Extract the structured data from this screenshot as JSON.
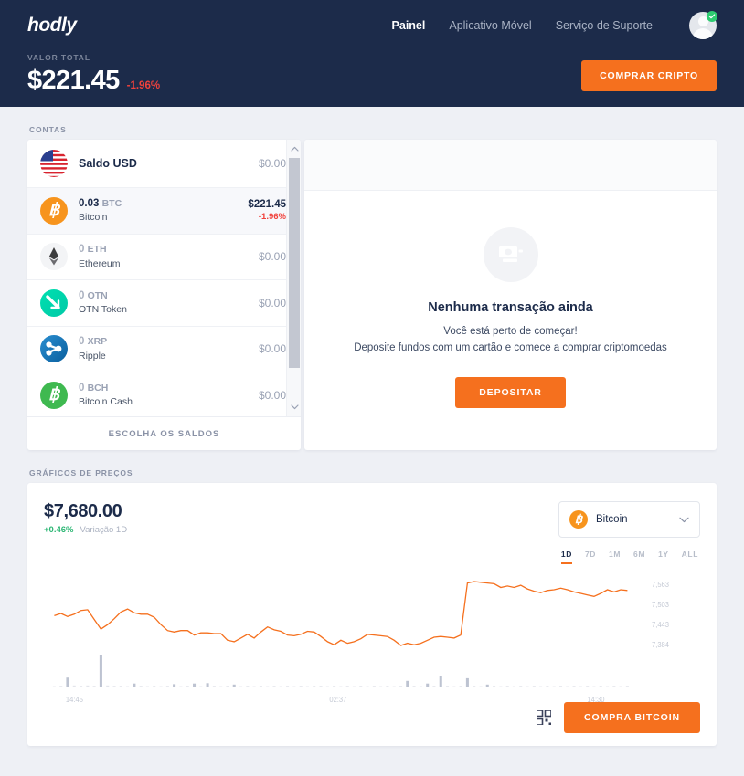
{
  "header": {
    "logo": "hodly",
    "nav": [
      {
        "label": "Painel",
        "active": true
      },
      {
        "label": "Aplicativo Móvel",
        "active": false
      },
      {
        "label": "Serviço de Suporte",
        "active": false
      }
    ],
    "avatar_icon": "user-avatar-icon",
    "avatar_badge_icon": "verified-check-icon",
    "total_label": "VALOR TOTAL",
    "total_value": "$221.45",
    "total_change": "-1.96%",
    "buy_crypto_label": "COMPRAR CRIPTO",
    "bg_color": "#1c2b4a",
    "accent_color": "#f5701e",
    "negative_color": "#f0423c"
  },
  "accounts": {
    "section_label": "CONTAS",
    "rows": [
      {
        "icon": "usd-flag-icon",
        "amount": "",
        "ticker": "",
        "title": "Saldo USD",
        "value": "$0.00",
        "delta": "",
        "selected": false,
        "single_line": true
      },
      {
        "icon": "bitcoin-icon",
        "amount": "0.03",
        "ticker": "BTC",
        "title": "Bitcoin",
        "value": "$221.45",
        "delta": "-1.96%",
        "selected": true,
        "single_line": false
      },
      {
        "icon": "ethereum-icon",
        "amount": "0",
        "ticker": "ETH",
        "title": "Ethereum",
        "value": "$0.00",
        "delta": "",
        "selected": false,
        "single_line": false
      },
      {
        "icon": "otn-token-icon",
        "amount": "0",
        "ticker": "OTN",
        "title": "OTN Token",
        "value": "$0.00",
        "delta": "",
        "selected": false,
        "single_line": false
      },
      {
        "icon": "ripple-icon",
        "amount": "0",
        "ticker": "XRP",
        "title": "Ripple",
        "value": "$0.00",
        "delta": "",
        "selected": false,
        "single_line": false
      },
      {
        "icon": "bitcoin-cash-icon",
        "amount": "0",
        "ticker": "BCH",
        "title": "Bitcoin Cash",
        "value": "$0.00",
        "delta": "",
        "selected": false,
        "single_line": false
      }
    ],
    "footer_label": "ESCOLHA OS SALDOS",
    "scroll_up_icon": "chevron-up-icon",
    "scroll_down_icon": "chevron-down-icon"
  },
  "empty_state": {
    "icon": "banknote-icon",
    "title": "Nenhuma transação ainda",
    "line1": "Você está perto de começar!",
    "line2": "Deposite fundos com um cartão e comece a comprar criptomoedas",
    "deposit_label": "DEPOSITAR"
  },
  "charts": {
    "section_label": "GRÁFICOS DE PREÇOS",
    "price": "$7,680.00",
    "delta": "+0.46%",
    "delta_label": "Variação 1D",
    "delta_color": "#2bb673",
    "coin_selector": {
      "icon": "bitcoin-icon",
      "label": "Bitcoin",
      "chevron_icon": "chevron-down-icon"
    },
    "ranges": [
      {
        "label": "1D",
        "active": true
      },
      {
        "label": "7D",
        "active": false
      },
      {
        "label": "1M",
        "active": false
      },
      {
        "label": "6M",
        "active": false
      },
      {
        "label": "1Y",
        "active": false
      },
      {
        "label": "ALL",
        "active": false
      }
    ],
    "qr_icon": "qr-code-icon",
    "buy_label": "COMPRA BITCOIN"
  },
  "chart_data": {
    "type": "line",
    "title": "Bitcoin price 1D",
    "xlabel": "",
    "ylabel": "",
    "grid": false,
    "legend": null,
    "line_color": "#f5701e",
    "volume_color": "#9aa3b8",
    "x_tick_labels": [
      "14:45",
      "02:37",
      "14:30"
    ],
    "x_tick_positions": [
      0.02,
      0.48,
      0.93
    ],
    "y_tick_labels": [
      "7,563",
      "7,503",
      "7,443",
      "7,384"
    ],
    "ylim": [
      7354,
      7593
    ],
    "series": [
      {
        "name": "Bitcoin",
        "values": [
          7496,
          7499,
          7495,
          7498,
          7503,
          7504,
          7491,
          7478,
          7484,
          7492,
          7501,
          7505,
          7500,
          7498,
          7498,
          7494,
          7484,
          7476,
          7474,
          7476,
          7476,
          7470,
          7473,
          7473,
          7472,
          7472,
          7463,
          7461,
          7466,
          7471,
          7466,
          7474,
          7481,
          7477,
          7475,
          7470,
          7469,
          7471,
          7475,
          7474,
          7468,
          7461,
          7457,
          7463,
          7459,
          7461,
          7465,
          7471,
          7470,
          7469,
          7468,
          7463,
          7456,
          7459,
          7457,
          7459,
          7463,
          7467,
          7468,
          7467,
          7466,
          7470,
          7540,
          7542,
          7541,
          7540,
          7539,
          7534,
          7536,
          7534,
          7537,
          7532,
          7529,
          7527,
          7530,
          7531,
          7533,
          7531,
          7528,
          7526,
          7524,
          7522,
          7526,
          7531,
          7528,
          7531,
          7530
        ]
      }
    ],
    "volume": [
      0.04,
      0.05,
      0.3,
      0.06,
      0.05,
      0.06,
      0.05,
      1.0,
      0.06,
      0.05,
      0.05,
      0.04,
      0.12,
      0.05,
      0.04,
      0.05,
      0.04,
      0.05,
      0.1,
      0.04,
      0.05,
      0.12,
      0.04,
      0.13,
      0.05,
      0.04,
      0.05,
      0.09,
      0.04,
      0.05,
      0.04,
      0.05,
      0.04,
      0.05,
      0.04,
      0.05,
      0.04,
      0.05,
      0.04,
      0.05,
      0.05,
      0.04,
      0.05,
      0.04,
      0.05,
      0.04,
      0.05,
      0.04,
      0.05,
      0.04,
      0.05,
      0.04,
      0.05,
      0.2,
      0.05,
      0.04,
      0.12,
      0.05,
      0.35,
      0.05,
      0.04,
      0.05,
      0.28,
      0.05,
      0.04,
      0.09,
      0.05,
      0.04,
      0.05,
      0.04,
      0.05,
      0.04,
      0.05,
      0.04,
      0.05,
      0.04,
      0.05,
      0.04,
      0.05,
      0.04,
      0.05,
      0.04,
      0.05,
      0.04,
      0.05,
      0.04,
      0.05
    ]
  }
}
